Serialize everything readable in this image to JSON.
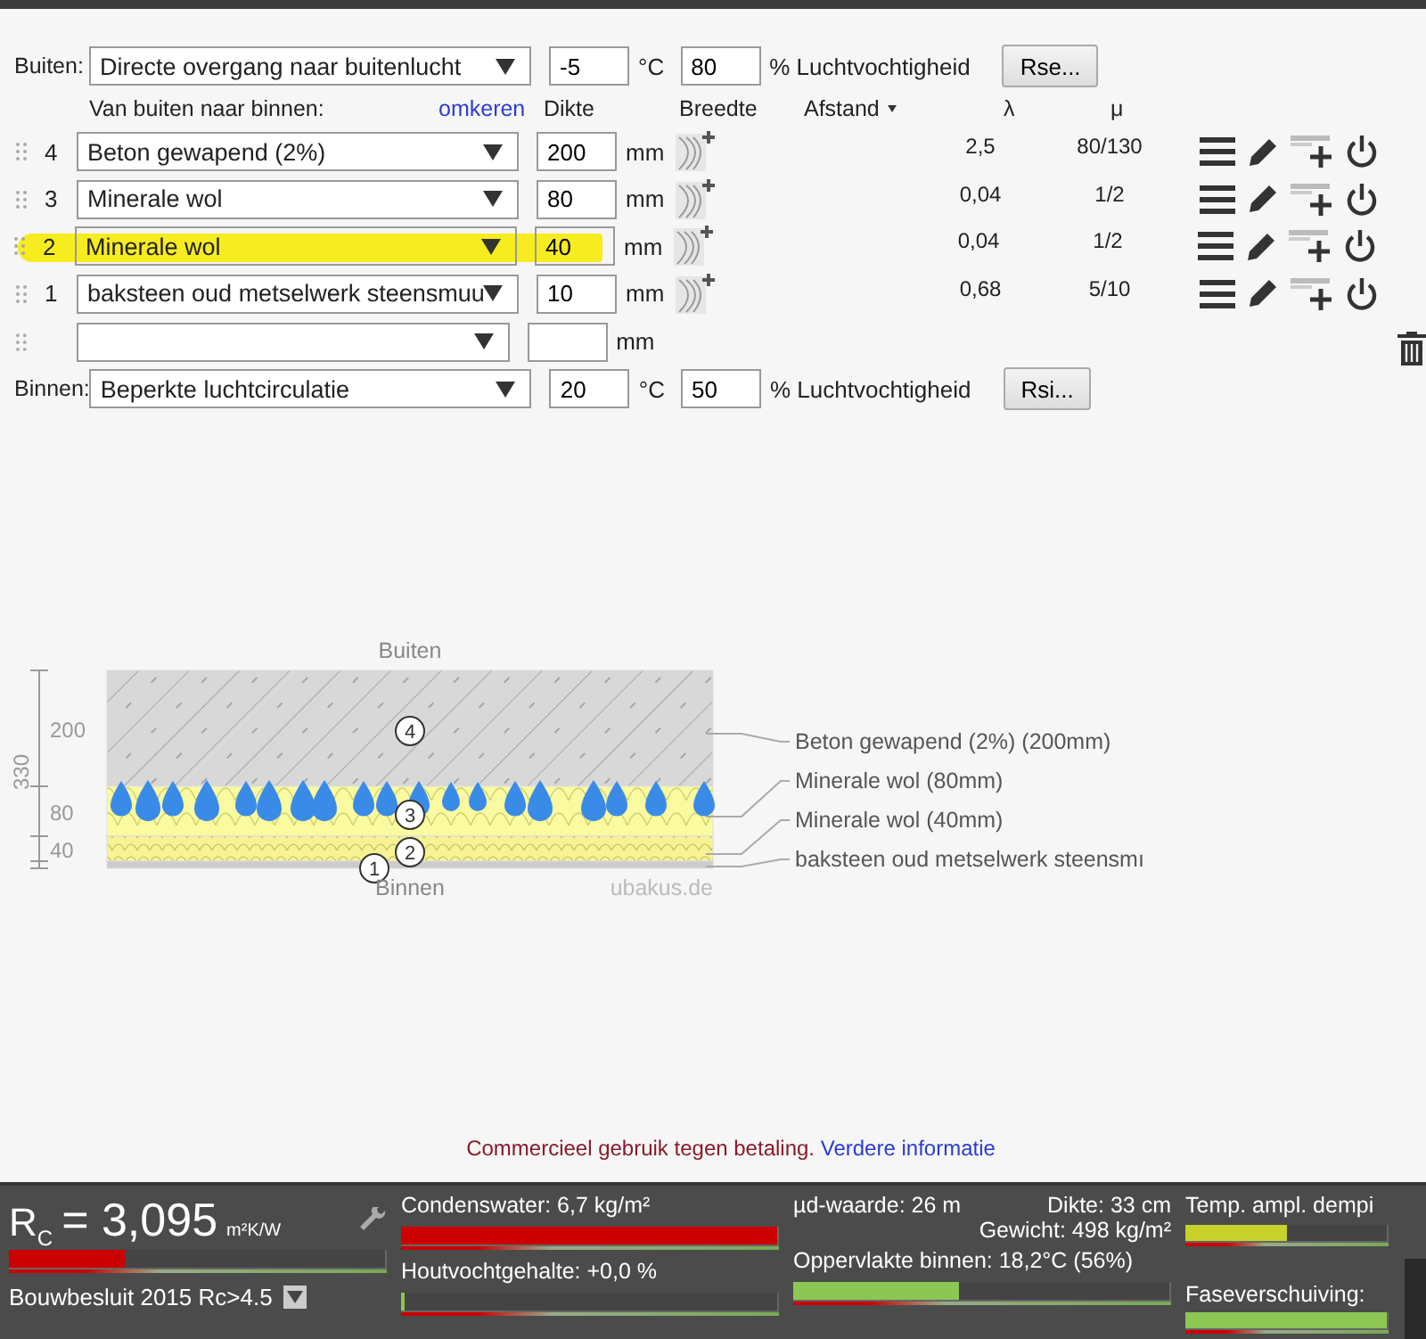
{
  "outside": {
    "label": "Buiten:",
    "condition": "Directe overgang naar buitenlucht",
    "temperature": "-5",
    "temperature_unit": "°C",
    "humidity": "80",
    "humidity_label": "% Luchtvochtigheid",
    "button": "Rse..."
  },
  "columns": {
    "direction": "Van buiten naar binnen:",
    "reverse_link": "omkeren",
    "thickness": "Dikte",
    "width": "Breedte",
    "spacing": "Afstand",
    "lambda": "λ",
    "mu": "μ"
  },
  "layers": [
    {
      "number": "4",
      "material": "Beton gewapend (2%)",
      "thickness": "200",
      "unit": "mm",
      "lambda": "2,5",
      "mu": "80/130",
      "highlighted": false
    },
    {
      "number": "3",
      "material": "Minerale wol",
      "thickness": "80",
      "unit": "mm",
      "lambda": "0,04",
      "mu": "1/2",
      "highlighted": false
    },
    {
      "number": "2",
      "material": "Minerale wol",
      "thickness": "40",
      "unit": "mm",
      "lambda": "0,04",
      "mu": "1/2",
      "highlighted": true
    },
    {
      "number": "1",
      "material": "baksteen oud metselwerk steensmuu",
      "thickness": "10",
      "unit": "mm",
      "lambda": "0,68",
      "mu": "5/10",
      "highlighted": false
    }
  ],
  "empty_row": {
    "unit": "mm"
  },
  "inside": {
    "label": "Binnen:",
    "condition": "Beperkte luchtcirculatie",
    "temperature": "20",
    "temperature_unit": "°C",
    "humidity": "50",
    "humidity_label": "% Luchtvochtigheid",
    "button": "Rsi..."
  },
  "diagram": {
    "top_label": "Buiten",
    "bottom_label": "Binnen",
    "total": "330",
    "site": "ubakus.de",
    "layers": [
      {
        "kind": "concrete",
        "number": "4",
        "dimension": "200",
        "caption": "Beton gewapend (2%) (200mm)"
      },
      {
        "kind": "wool_wet",
        "number": "3",
        "dimension": "80",
        "caption": "Minerale wol (80mm)"
      },
      {
        "kind": "wool",
        "number": "2",
        "dimension": "40",
        "caption": "Minerale wol (40mm)"
      },
      {
        "kind": "brick",
        "number": "1",
        "caption": "baksteen oud metselwerk steensmı"
      }
    ]
  },
  "notice": {
    "text": "Commercieel gebruik tegen betaling.",
    "link": "Verdere informatie"
  },
  "results": {
    "rc": {
      "symbol": "R",
      "subscript": "C",
      "value": "= 3,095",
      "unit": "m²K/W",
      "level": 0.31,
      "standard": "Bouwbesluit 2015 Rc>4.5"
    },
    "condensate": {
      "label": "Condenswater: 6,7 kg/m²",
      "level": 1.0
    },
    "wood_moisture": {
      "label": "Houtvochtgehalte: +0,0 %",
      "level": 0.01
    },
    "sd_value": "µd-waarde: 26 m",
    "thickness": "Dikte: 33 cm",
    "weight": "Gewicht: 498 kg/m²",
    "surface": {
      "label": "Oppervlakte binnen: 18,2°C (56%)",
      "level": 0.44
    },
    "temp_damping": {
      "label": "Temp. ampl. dempi",
      "level": 0.5
    },
    "phase_shift": {
      "label": "Faseverschuiving:",
      "level": 1.0
    }
  }
}
